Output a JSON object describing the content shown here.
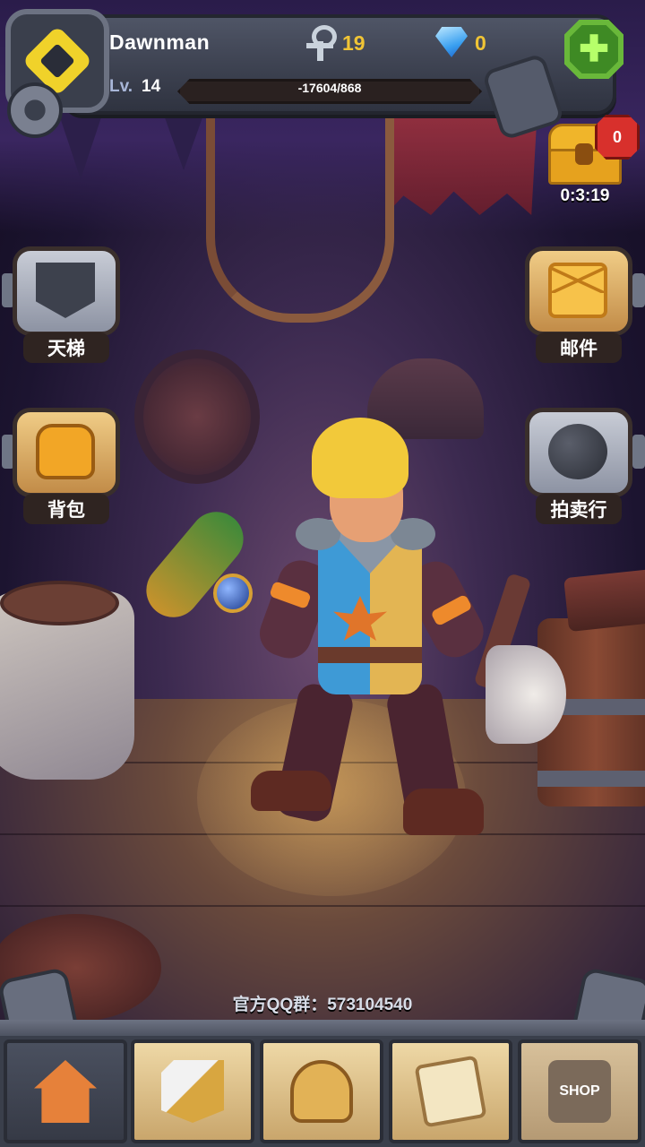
{
  "header": {
    "player_name": "Dawnman",
    "level_label": "Lv.",
    "level_value": "14",
    "xp_text": "-17604/868",
    "ankh_count": "19",
    "gem_count": "0"
  },
  "chest": {
    "badge": "0",
    "timer": "0:3:19"
  },
  "side_buttons": {
    "ladder": "天梯",
    "mail": "邮件",
    "backpack": "背包",
    "auction": "拍卖行"
  },
  "footer": {
    "qq_group": "官方QQ群：573104540"
  },
  "nav": {
    "shop_label": "SHOP",
    "active_tab": "home"
  },
  "colors": {
    "currency": "#f0c435",
    "plus_button": "#69b83a",
    "badge": "#d8302c"
  },
  "icons": [
    "guild-emblem-icon",
    "settings-gear-icon",
    "ankh-icon",
    "diamond-icon",
    "plus-icon",
    "treasure-chest-icon",
    "banner-icon",
    "mail-icon",
    "backpack-icon",
    "auction-icon",
    "home-icon",
    "battle-sword-icon",
    "helmet-icon",
    "quest-scroll-icon",
    "shop-icon"
  ]
}
